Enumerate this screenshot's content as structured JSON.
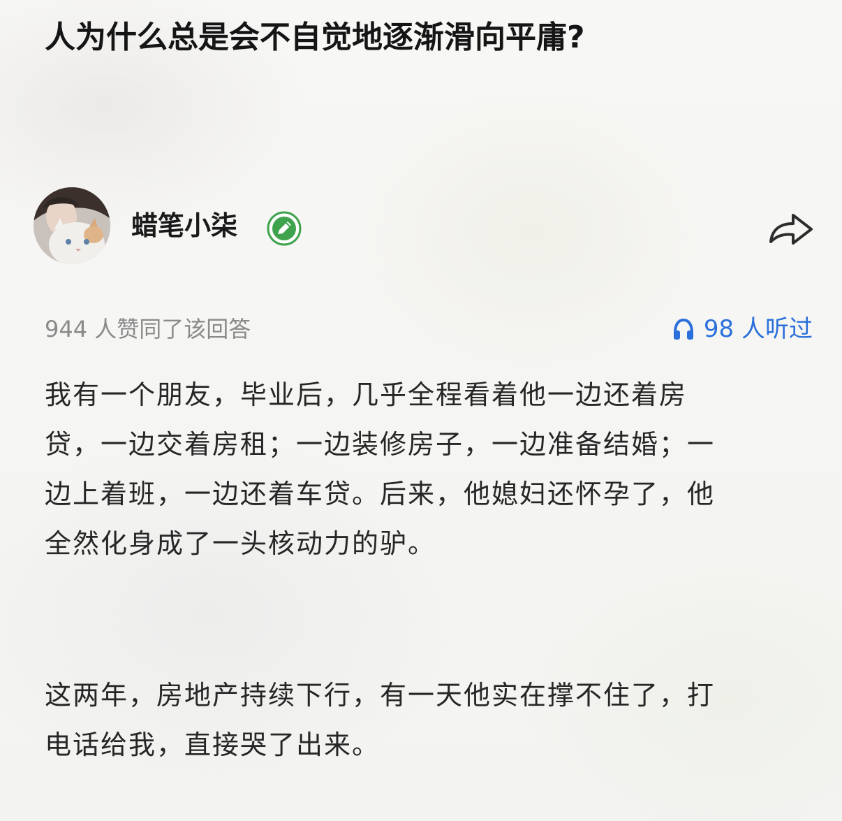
{
  "question": {
    "title": "人为什么总是会不自觉地逐渐滑向平庸?"
  },
  "author": {
    "name": "蜡笔小柒",
    "avatar_icon": "avatar-photo-with-cat",
    "badge_icon": "verified-pen-icon",
    "badge_color": "#3fa34d"
  },
  "share": {
    "icon": "share-arrow-icon"
  },
  "meta": {
    "votes_text": "944 人赞同了该回答",
    "listen_icon": "headphones-icon",
    "listen_text": "98 人听过",
    "accent_color": "#2a6fdb"
  },
  "answer": {
    "paragraphs": [
      {
        "lines": [
          "我有一个朋友，毕业后，几乎全程看着他一边还着房",
          "贷，一边交着房租；一边装修房子，一边准备结婚；一",
          "边上着班，一边还着车贷。后来，他媳妇还怀孕了，他",
          "全然化身成了一头核动力的驴。"
        ]
      },
      {
        "lines": [
          "这两年，房地产持续下行，有一天他实在撑不住了，打",
          "电话给我，直接哭了出来。"
        ]
      }
    ]
  }
}
